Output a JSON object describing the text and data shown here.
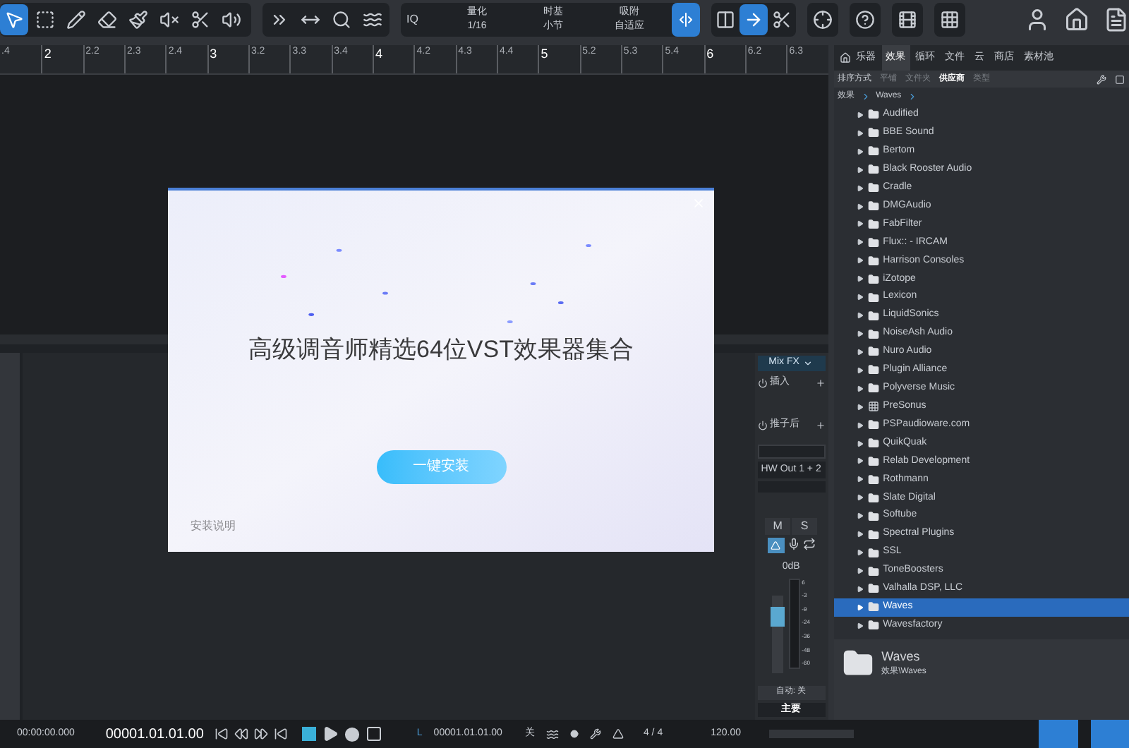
{
  "toolbar": {
    "tools": [
      {
        "kind": "pointer",
        "selected": true
      },
      {
        "kind": "range",
        "selected": false
      },
      {
        "kind": "pencil",
        "selected": false
      },
      {
        "kind": "eraser",
        "selected": false
      },
      {
        "kind": "paint",
        "selected": false
      },
      {
        "kind": "mute",
        "selected": false
      },
      {
        "kind": "split",
        "selected": false
      },
      {
        "kind": "listen",
        "selected": false
      }
    ],
    "edit_tools": [
      {
        "kind": "bend"
      },
      {
        "kind": "stretch"
      },
      {
        "kind": "quantize"
      },
      {
        "kind": "groove"
      }
    ],
    "iq": "IQ",
    "quantize": {
      "label": "量化",
      "value": "1/16"
    },
    "timebase": {
      "label": "时基",
      "value": "小节"
    },
    "snap": {
      "label": "吸附",
      "value": "自适应",
      "on": true
    },
    "modes": [
      {
        "kind": "link",
        "selected": false
      },
      {
        "kind": "follow",
        "selected": true
      },
      {
        "kind": "split",
        "selected": false
      }
    ],
    "extras": [
      {
        "kind": "target"
      },
      {
        "kind": "help"
      },
      {
        "kind": "film"
      },
      {
        "kind": "grid"
      }
    ],
    "right": [
      {
        "kind": "user"
      },
      {
        "kind": "home"
      },
      {
        "kind": "doc"
      }
    ]
  },
  "ruler": [
    ".4",
    "2",
    "2.2",
    "2.3",
    "2.4",
    "3",
    "3.2",
    "3.3",
    "3.4",
    "4",
    "4.2",
    "4.3",
    "4.4",
    "5",
    "5.2",
    "5.3",
    "5.4",
    "6",
    "6.2",
    "6.3"
  ],
  "dialog": {
    "title": "高级调音师精选64位VST效果器集合",
    "install_button": "一键安装",
    "help_link": "安装说明"
  },
  "mixer": {
    "mix_fx": "Mix FX",
    "inserts": "插入",
    "post_fader": "推子后",
    "output": "HW Out 1 + 2",
    "mute": "M",
    "solo": "S",
    "mute_on": false,
    "solo_on": false,
    "monitor_on": true,
    "volume": "0dB",
    "level": 0.8,
    "scale": [
      "6",
      "-3",
      "-9",
      "-24",
      "-36",
      "-48",
      "-60"
    ],
    "automation": "自动: 关",
    "name": "主要"
  },
  "browser": {
    "tabs": [
      {
        "label": "乐器",
        "selected": false
      },
      {
        "label": "效果",
        "selected": true
      },
      {
        "label": "循环",
        "selected": false
      },
      {
        "label": "文件",
        "selected": false
      },
      {
        "label": "云",
        "selected": false
      },
      {
        "label": "商店",
        "selected": false
      },
      {
        "label": "素材池",
        "selected": false
      }
    ],
    "sort_label": "排序方式",
    "sort_options": [
      {
        "label": "平铺",
        "selected": false
      },
      {
        "label": "文件夹",
        "selected": false
      },
      {
        "label": "供应商",
        "selected": true
      },
      {
        "label": "类型",
        "selected": false
      }
    ],
    "breadcrumb": [
      "效果",
      "Waves"
    ],
    "items": [
      {
        "label": "Audified",
        "kind": "folder",
        "selected": false
      },
      {
        "label": "BBE Sound",
        "kind": "folder",
        "selected": false
      },
      {
        "label": "Bertom",
        "kind": "folder",
        "selected": false
      },
      {
        "label": "Black Rooster Audio",
        "kind": "folder",
        "selected": false
      },
      {
        "label": "Cradle",
        "kind": "folder",
        "selected": false
      },
      {
        "label": "DMGAudio",
        "kind": "folder",
        "selected": false
      },
      {
        "label": "FabFilter",
        "kind": "folder",
        "selected": false
      },
      {
        "label": "Flux:: - IRCAM",
        "kind": "folder",
        "selected": false
      },
      {
        "label": "Harrison Consoles",
        "kind": "folder",
        "selected": false
      },
      {
        "label": "iZotope",
        "kind": "folder",
        "selected": false
      },
      {
        "label": "Lexicon",
        "kind": "folder",
        "selected": false
      },
      {
        "label": "LiquidSonics",
        "kind": "folder",
        "selected": false
      },
      {
        "label": "NoiseAsh Audio",
        "kind": "folder",
        "selected": false
      },
      {
        "label": "Nuro Audio",
        "kind": "folder",
        "selected": false
      },
      {
        "label": "Plugin Alliance",
        "kind": "folder",
        "selected": false
      },
      {
        "label": "Polyverse Music",
        "kind": "folder",
        "selected": false
      },
      {
        "label": "PreSonus",
        "kind": "vendor",
        "selected": false
      },
      {
        "label": "PSPaudioware.com",
        "kind": "folder",
        "selected": false
      },
      {
        "label": "QuikQuak",
        "kind": "folder",
        "selected": false
      },
      {
        "label": "Relab Development",
        "kind": "folder",
        "selected": false
      },
      {
        "label": "Rothmann",
        "kind": "folder",
        "selected": false
      },
      {
        "label": "Slate Digital",
        "kind": "folder",
        "selected": false
      },
      {
        "label": "Softube",
        "kind": "folder",
        "selected": false
      },
      {
        "label": "Spectral Plugins",
        "kind": "folder",
        "selected": false
      },
      {
        "label": "SSL",
        "kind": "folder",
        "selected": false
      },
      {
        "label": "ToneBoosters",
        "kind": "folder",
        "selected": false
      },
      {
        "label": "Valhalla DSP, LLC",
        "kind": "folder",
        "selected": false
      },
      {
        "label": "Waves",
        "kind": "folder",
        "selected": true
      },
      {
        "label": "Wavesfactory",
        "kind": "folder",
        "selected": false
      }
    ],
    "info": {
      "name": "Waves",
      "path": "效果\\Waves"
    }
  },
  "transport": {
    "time": "00:00:00.000",
    "bars": "00001.01.01.00",
    "loop_marker": "L",
    "loop_start": "00001.01.01.00",
    "off": "关",
    "signature": "4 / 4",
    "tempo": "120.00",
    "stopped": true
  }
}
